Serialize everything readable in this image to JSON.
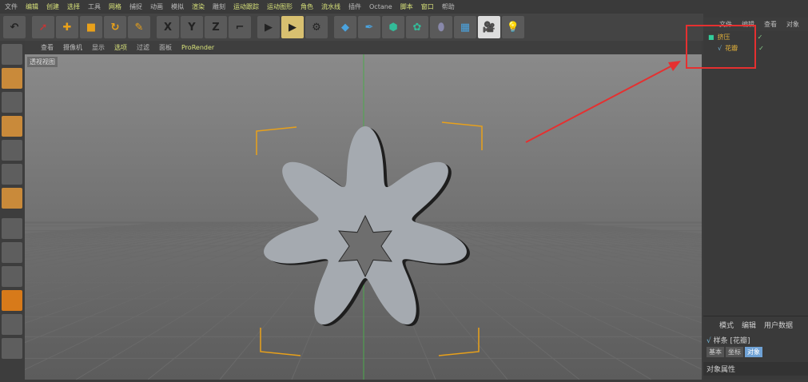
{
  "menu": [
    "文件",
    "编辑",
    "创建",
    "选择",
    "工具",
    "网格",
    "捕捉",
    "动画",
    "模拟",
    "渲染",
    "雕刻",
    "运动跟踪",
    "运动图形",
    "角色",
    "流水线",
    "插件",
    "Octane",
    "脚本",
    "窗口",
    "帮助"
  ],
  "toolbar": {
    "x": "X",
    "y": "Y",
    "z": "Z"
  },
  "viewport": {
    "menu": [
      "查看",
      "摄像机",
      "显示",
      "选项",
      "过滤",
      "面板",
      "ProRender"
    ],
    "label": "透视视图"
  },
  "object_manager": {
    "tabs": [
      "文件",
      "编辑",
      "查看",
      "对象"
    ],
    "objects": [
      "挤压",
      "花瓣"
    ]
  },
  "attributes": {
    "tabs": [
      "模式",
      "编辑",
      "用户数据"
    ],
    "title": "样条 [花瓣]",
    "buttons": [
      "基本",
      "坐标",
      "对象"
    ],
    "section": "对象属性"
  },
  "colors": {
    "accent": "#d8e27a",
    "annotation": "#e53030",
    "object": "#e3b23a"
  }
}
